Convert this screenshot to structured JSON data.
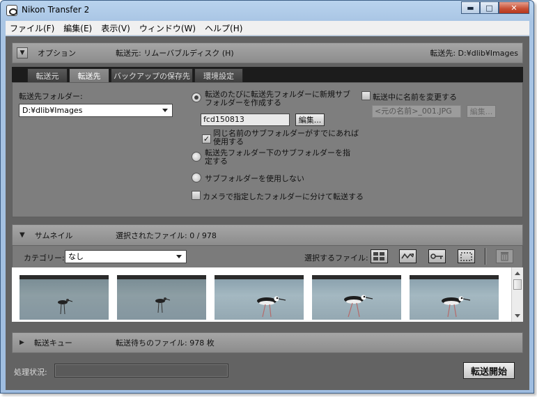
{
  "window": {
    "title": "Nikon Transfer 2",
    "minimize": "▬",
    "maximize": "□",
    "close": "✕"
  },
  "menu": [
    "ファイル(F)",
    "編集(E)",
    "表示(V)",
    "ウィンドウ(W)",
    "ヘルプ(H)"
  ],
  "options": {
    "title": "オプション",
    "source": "転送元: リムーバブルディスク (H)",
    "destination": "転送先: D:¥dlib¥Images",
    "tabs": [
      "転送元",
      "転送先",
      "バックアップの保存先",
      "環境設定"
    ],
    "active_tab": "転送先",
    "dest_folder_label": "転送先フォルダー:",
    "dest_folder_value": "D:¥dlib¥Images",
    "radio_new_subfolder": "転送のたびに転送先フォルダーに新規サブフォルダーを作成する",
    "subfolder_name": "fcd150813",
    "edit_button": "編集...",
    "check_same_name": "同じ名前のサブフォルダーがすでにあれば使用する",
    "radio_specify_subfolder": "転送先フォルダー下のサブフォルダーを指定する",
    "radio_no_subfolder": "サブフォルダーを使用しない",
    "check_camera_folders": "カメラで指定したフォルダーに分けて転送する",
    "check_rename": "転送中に名前を変更する",
    "rename_example": "<元の名前>_001.JPG",
    "rename_edit_button": "編集..."
  },
  "thumbnails": {
    "title": "サムネイル",
    "selected": "選択されたファイル: 0 / 978",
    "category_label": "カテゴリー:",
    "category_value": "なし",
    "select_files_label": "選択するファイル:"
  },
  "queue": {
    "title": "転送キュー",
    "pending": "転送待ちのファイル: 978 枚"
  },
  "status": {
    "label": "処理状況:",
    "start_button": "転送開始"
  }
}
